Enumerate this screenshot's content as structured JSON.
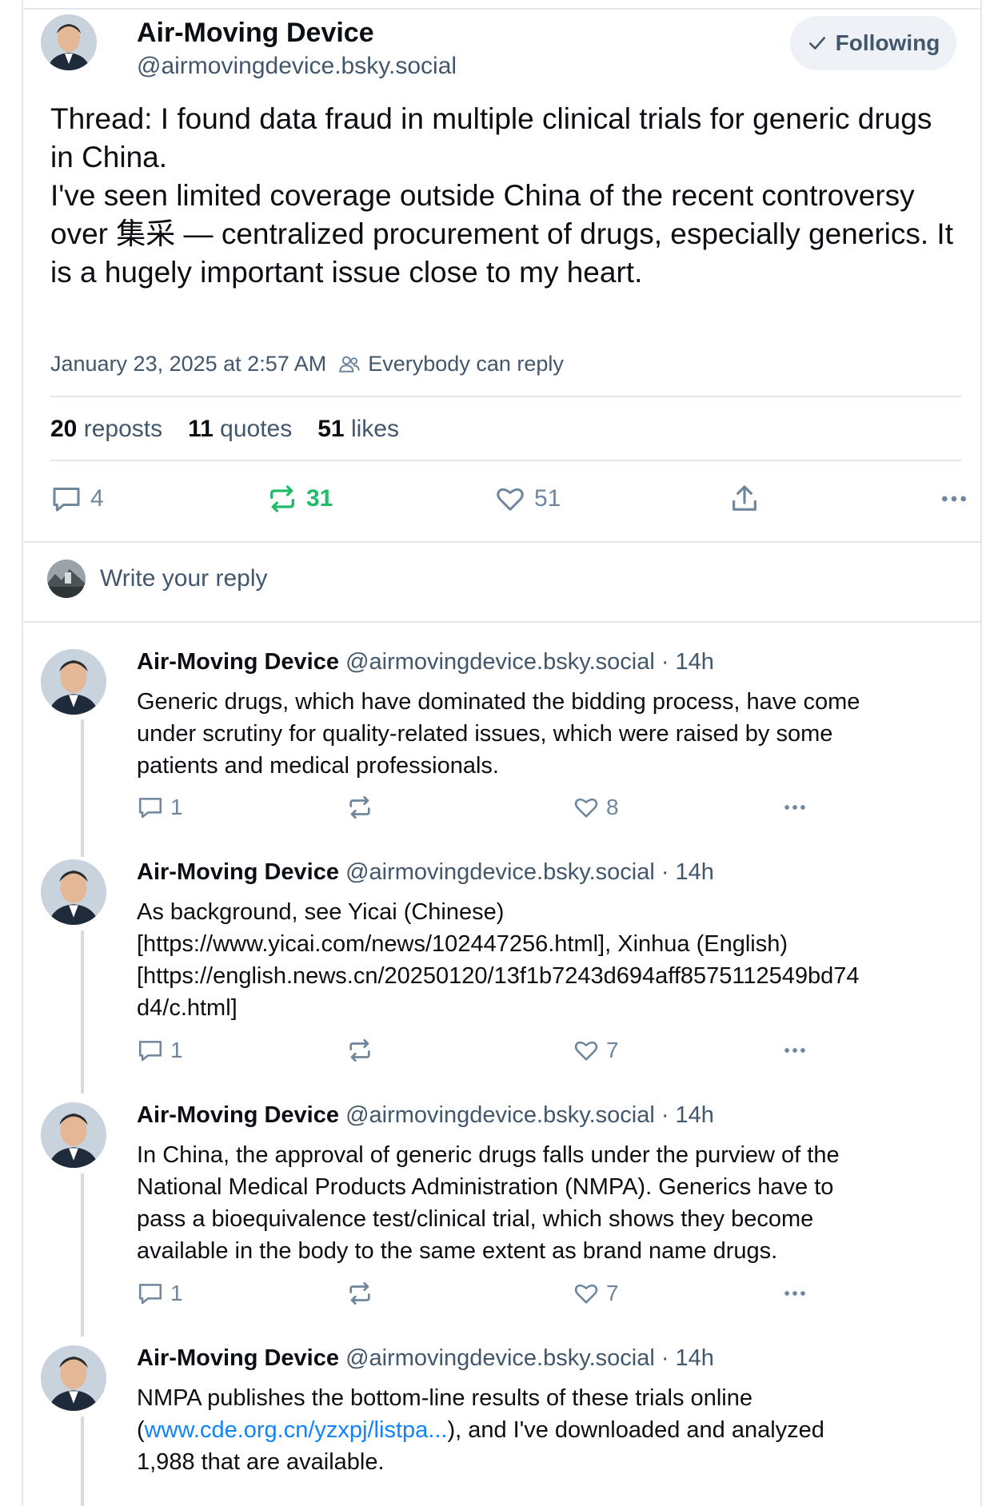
{
  "main_post": {
    "author_name": "Air-Moving Device",
    "author_handle": "@airmovingdevice.bsky.social",
    "follow_label": "Following",
    "text_lines": [
      "Thread: I found data fraud in multiple clinical trials for generic drugs in China.",
      "I've seen limited coverage outside China of the recent controversy over 集采 — centralized procurement of drugs, especially generics. It is a hugely important issue close to my heart."
    ],
    "timestamp": "January 23, 2025 at 2:57 AM",
    "reply_setting": "Everybody can reply",
    "stats": {
      "reposts_count": "20",
      "reposts_label": "reposts",
      "quotes_count": "11",
      "quotes_label": "quotes",
      "likes_count": "51",
      "likes_label": "likes"
    },
    "actions": {
      "replies": "4",
      "reposts": "31",
      "likes": "51"
    }
  },
  "reply_composer": {
    "placeholder": "Write your reply"
  },
  "thread_posts": [
    {
      "name": "Air-Moving Device",
      "handle_time": "@airmovingdevice.bsky.social · 14h",
      "lines": [
        "Generic drugs, which have dominated the bidding process, have come",
        "under scrutiny for quality-related issues, which were raised by some",
        "patients and medical professionals."
      ],
      "replies": "1",
      "reposts": "",
      "likes": "8"
    },
    {
      "name": "Air-Moving Device",
      "handle_time": "@airmovingdevice.bsky.social · 14h",
      "lines": [
        "As background, see Yicai (Chinese)",
        "[https://www.yicai.com/news/102447256.html], Xinhua (English)",
        "[https://english.news.cn/20250120/13f1b7243d694aff8575112549bd74",
        "d4/c.html]"
      ],
      "replies": "1",
      "reposts": "",
      "likes": "7"
    },
    {
      "name": "Air-Moving Device",
      "handle_time": "@airmovingdevice.bsky.social · 14h",
      "lines": [
        "In China, the approval of generic drugs falls under the purview of the",
        "National Medical Products Administration (NMPA). Generics have to",
        "pass a bioequivalence test/clinical trial, which shows they become",
        "available in the body to the same extent as brand name drugs."
      ],
      "replies": "1",
      "reposts": "",
      "likes": "7"
    },
    {
      "name": "Air-Moving Device",
      "handle_time": "@airmovingdevice.bsky.social · 14h",
      "line1": "NMPA publishes the bottom-line results of these trials online",
      "line2_pre": "(",
      "line2_link": "www.cde.org.cn/yzxpj/listpa...",
      "line2_post": "), and I've downloaded and analyzed",
      "line3": "1,988 that are available."
    }
  ],
  "colors": {
    "accent_link": "#1083fe",
    "repost_green": "#20bc6a",
    "muted": "#42576c",
    "icon_gray": "#6f869f",
    "border": "#e3e8ee"
  },
  "icons": [
    "check-icon",
    "people-icon",
    "comment-icon",
    "repost-icon",
    "heart-icon",
    "share-icon",
    "more-icon"
  ]
}
